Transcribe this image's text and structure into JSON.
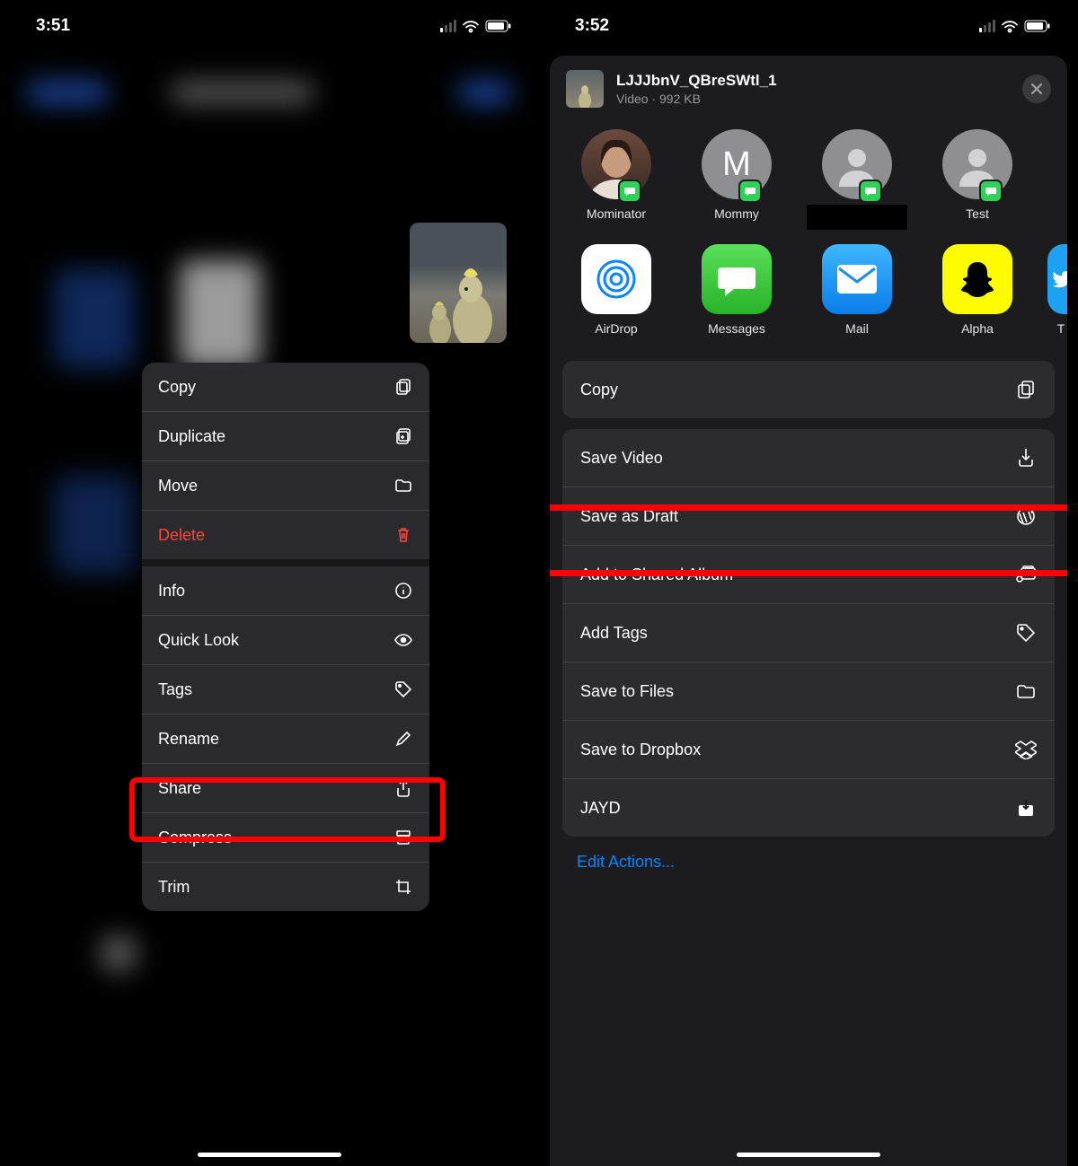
{
  "phone1": {
    "time": "3:51",
    "menu": {
      "copy": "Copy",
      "duplicate": "Duplicate",
      "move": "Move",
      "delete": "Delete",
      "info": "Info",
      "quicklook": "Quick Look",
      "tags": "Tags",
      "rename": "Rename",
      "share": "Share",
      "compress": "Compress",
      "trim": "Trim"
    }
  },
  "phone2": {
    "time": "3:52",
    "header": {
      "filename": "LJJJbnV_QBreSWtl_1",
      "subtitle": "Video · 992 KB"
    },
    "contacts": [
      {
        "name": "Mominator"
      },
      {
        "name": "Mommy"
      },
      {
        "name": ""
      },
      {
        "name": "Test"
      }
    ],
    "apps": [
      {
        "name": "AirDrop"
      },
      {
        "name": "Messages"
      },
      {
        "name": "Mail"
      },
      {
        "name": "Alpha"
      },
      {
        "name": "T"
      }
    ],
    "actions": {
      "copy": "Copy",
      "save_video": "Save Video",
      "save_draft": "Save as Draft",
      "shared_album": "Add to Shared Album",
      "add_tags": "Add Tags",
      "save_files": "Save to Files",
      "dropbox": "Save to Dropbox",
      "jayd": "JAYD"
    },
    "edit": "Edit Actions..."
  }
}
